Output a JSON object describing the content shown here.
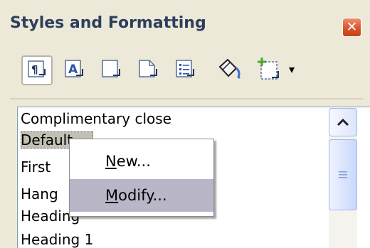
{
  "panel": {
    "title": "Styles and Formatting",
    "close_glyph": "✕"
  },
  "toolbar": {
    "buttons": [
      {
        "name": "paragraph-styles",
        "icon": "paragraph-styles-icon",
        "glyph": "¶",
        "active": true
      },
      {
        "name": "character-styles",
        "icon": "character-styles-icon",
        "glyph": "A"
      },
      {
        "name": "frame-styles",
        "icon": "frame-styles-icon"
      },
      {
        "name": "page-styles",
        "icon": "page-styles-icon"
      },
      {
        "name": "list-styles",
        "icon": "list-styles-icon"
      },
      {
        "name": "fill-format-mode",
        "icon": "paint-bucket-icon"
      },
      {
        "name": "new-style-from-selection",
        "icon": "new-style-icon"
      }
    ],
    "dropdown_glyph": "▾"
  },
  "list": {
    "items": [
      "Complimentary close",
      "Default",
      "First",
      "Hang",
      "Heading",
      "Heading 1"
    ],
    "selected_index": 1
  },
  "context_menu": {
    "items": [
      {
        "label": "New...",
        "mnemonic": "N"
      },
      {
        "label": "Modify...",
        "mnemonic": "M",
        "highlighted": true
      }
    ]
  },
  "colors": {
    "background": "#ece9d8",
    "title": "#2d3e5c",
    "close": "#d9542e",
    "highlight": "#b9b6c8"
  }
}
